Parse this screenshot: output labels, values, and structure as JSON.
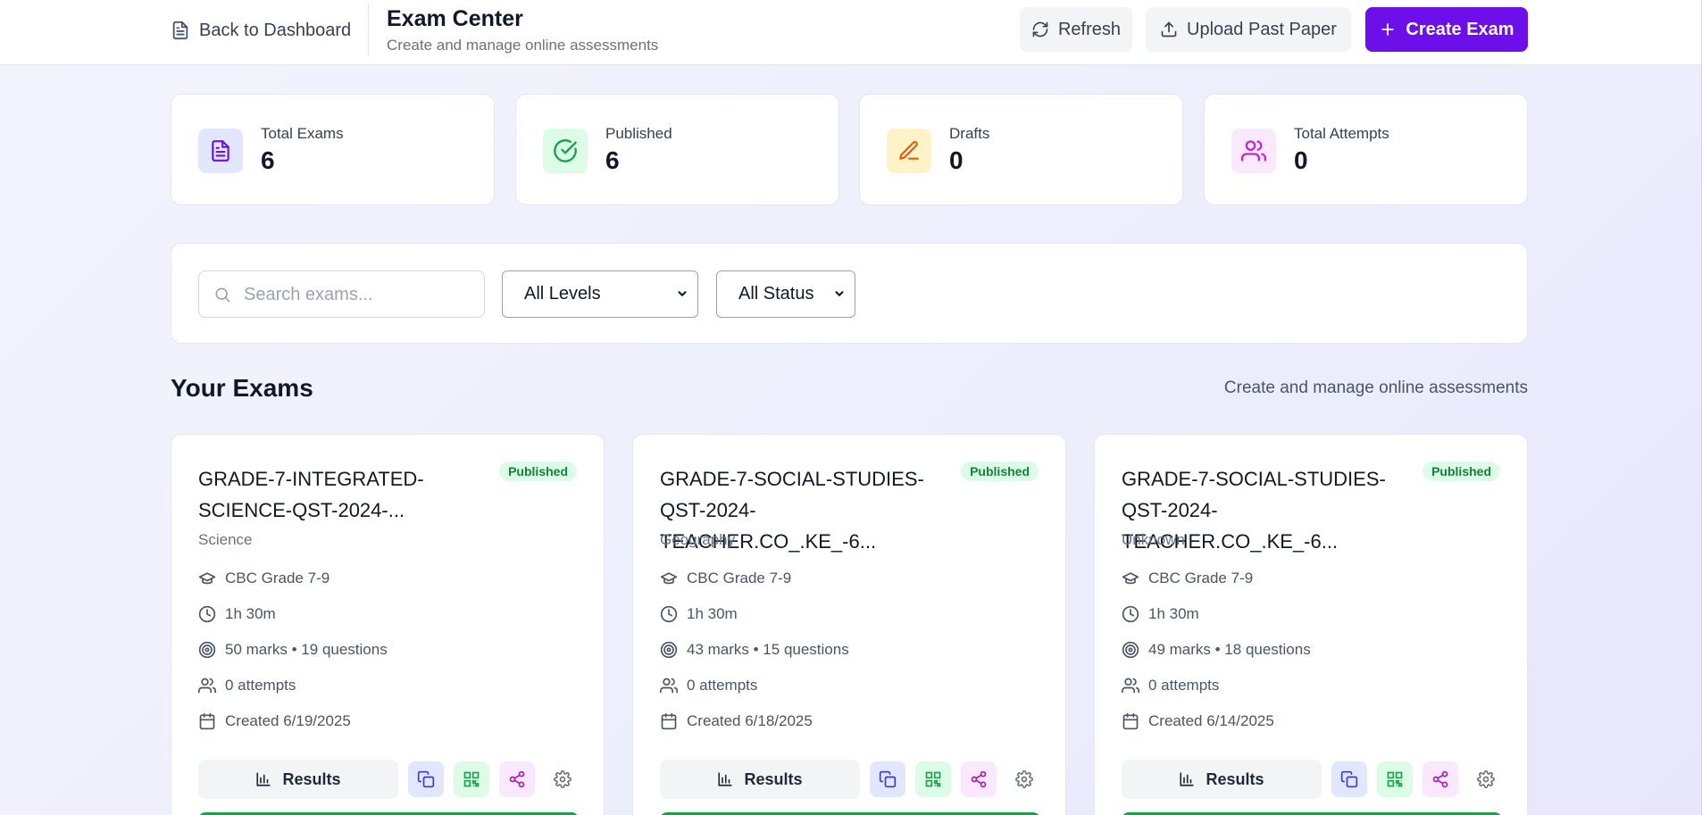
{
  "header": {
    "back_label": "Back to Dashboard",
    "title": "Exam Center",
    "subtitle": "Create and manage online assessments",
    "refresh_label": "Refresh",
    "upload_label": "Upload Past Paper",
    "create_label": "Create Exam"
  },
  "stats": [
    {
      "label": "Total Exams",
      "value": "6",
      "icon": "document-icon"
    },
    {
      "label": "Published",
      "value": "6",
      "icon": "check-circle-icon"
    },
    {
      "label": "Drafts",
      "value": "0",
      "icon": "pencil-icon"
    },
    {
      "label": "Total Attempts",
      "value": "0",
      "icon": "users-icon"
    }
  ],
  "filters": {
    "search_placeholder": "Search exams...",
    "levels_selected": "All Levels",
    "status_selected": "All Status"
  },
  "section": {
    "title": "Your Exams",
    "subtitle": "Create and manage online assessments"
  },
  "exams": [
    {
      "title": "GRADE-7-INTEGRATED-\nSCIENCE-QST-2024-...",
      "status": "Published",
      "subject": "Science",
      "level": "CBC Grade 7-9",
      "duration": "1h 30m",
      "marks": "50 marks • 19 questions",
      "attempts": "0 attempts",
      "created": "Created 6/19/2025",
      "results_label": "Results"
    },
    {
      "title": "GRADE-7-SOCIAL-STUDIES-\nQST-2024-TEACHER.CO_.KE_-6...",
      "status": "Published",
      "subject": "Geography",
      "level": "CBC Grade 7-9",
      "duration": "1h 30m",
      "marks": "43 marks • 15 questions",
      "attempts": "0 attempts",
      "created": "Created 6/18/2025",
      "results_label": "Results"
    },
    {
      "title": "GRADE-7-SOCIAL-STUDIES-\nQST-2024-TEACHER.CO_.KE_-6...",
      "status": "Published",
      "subject": "Unknown",
      "level": "CBC Grade 7-9",
      "duration": "1h 30m",
      "marks": "49 marks • 18 questions",
      "attempts": "0 attempts",
      "created": "Created 6/14/2025",
      "results_label": "Results"
    }
  ],
  "colors": {
    "primary": "#6d0fe8",
    "published_bg": "#dcfce7",
    "published_text": "#15803d"
  }
}
